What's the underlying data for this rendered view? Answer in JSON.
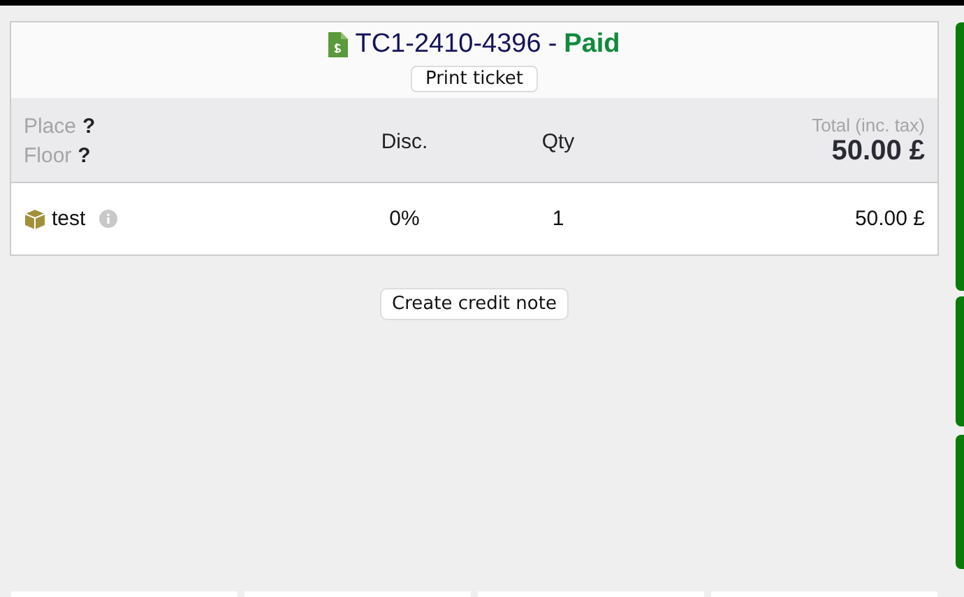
{
  "ticket": {
    "number": "TC1-2410-4396",
    "separator": "-",
    "status": {
      "text": "Paid",
      "kind": "paid"
    },
    "print_button": "Print ticket"
  },
  "header": {
    "place_label": "Place",
    "place_value": "?",
    "floor_label": "Floor",
    "floor_value": "?",
    "columns": [
      "Disc.",
      "Qty"
    ],
    "total_label": "Total (inc. tax)",
    "total": "50.00 £"
  },
  "lines": [
    {
      "name": "test",
      "discount": "0%",
      "qty": "1",
      "total": "50.00 £"
    }
  ],
  "credit_note_button": "Create credit note"
}
